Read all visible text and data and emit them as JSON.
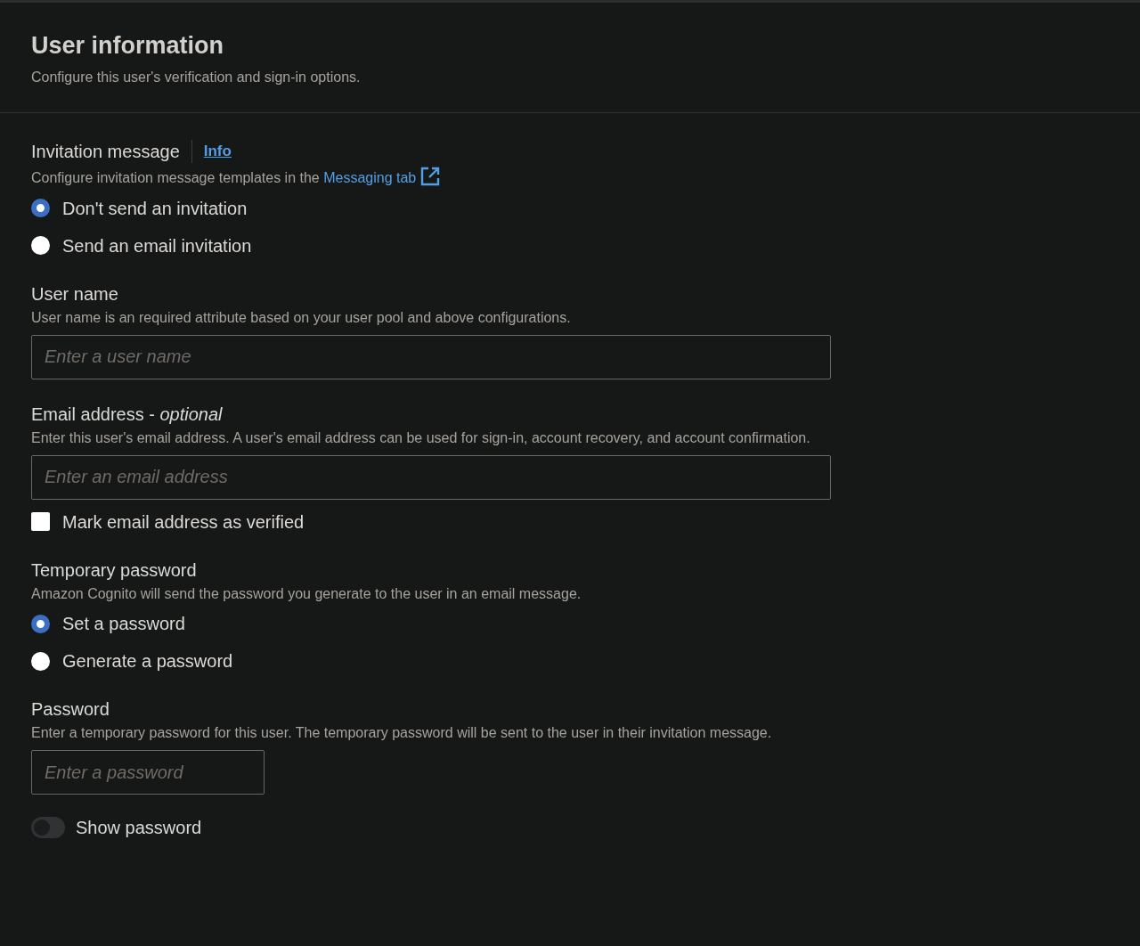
{
  "header": {
    "title": "User information",
    "description": "Configure this user's verification and sign-in options."
  },
  "sections": [
    {
      "kind": "radio-group",
      "label": "Invitation message",
      "info": "Info",
      "description": "Configure invitation message templates in the",
      "link": "Messaging tab",
      "options": [
        {
          "label": "Don't send an invitation",
          "selected": true
        },
        {
          "label": "Send an email invitation",
          "selected": false
        }
      ]
    },
    {
      "kind": "text-field",
      "label": "User name",
      "description": "User name is an required attribute based on your user pool and above configurations.",
      "placeholder": "Enter a user name"
    },
    {
      "kind": "text-field",
      "label": "Email address - *optional*",
      "description": "Enter this user's email address. A user's email address can be used for sign-in, account recovery, and account confirmation.",
      "placeholder": "Enter an email address",
      "checkbox": {
        "label": "Mark email address as verified",
        "checked": false
      }
    },
    {
      "kind": "radio-group",
      "label": "Temporary password",
      "description": "Amazon Cognito will send the password you generate to the user in an email message.",
      "options": [
        {
          "label": "Set a password",
          "selected": true
        },
        {
          "label": "Generate a password",
          "selected": false
        }
      ]
    },
    {
      "kind": "password-field",
      "label": "Password",
      "description": "Enter a temporary password for this user. The temporary password will be sent to the user in their invitation message.",
      "placeholder": "Enter a password",
      "toggle": {
        "label": "Show password",
        "on": false
      }
    }
  ]
}
